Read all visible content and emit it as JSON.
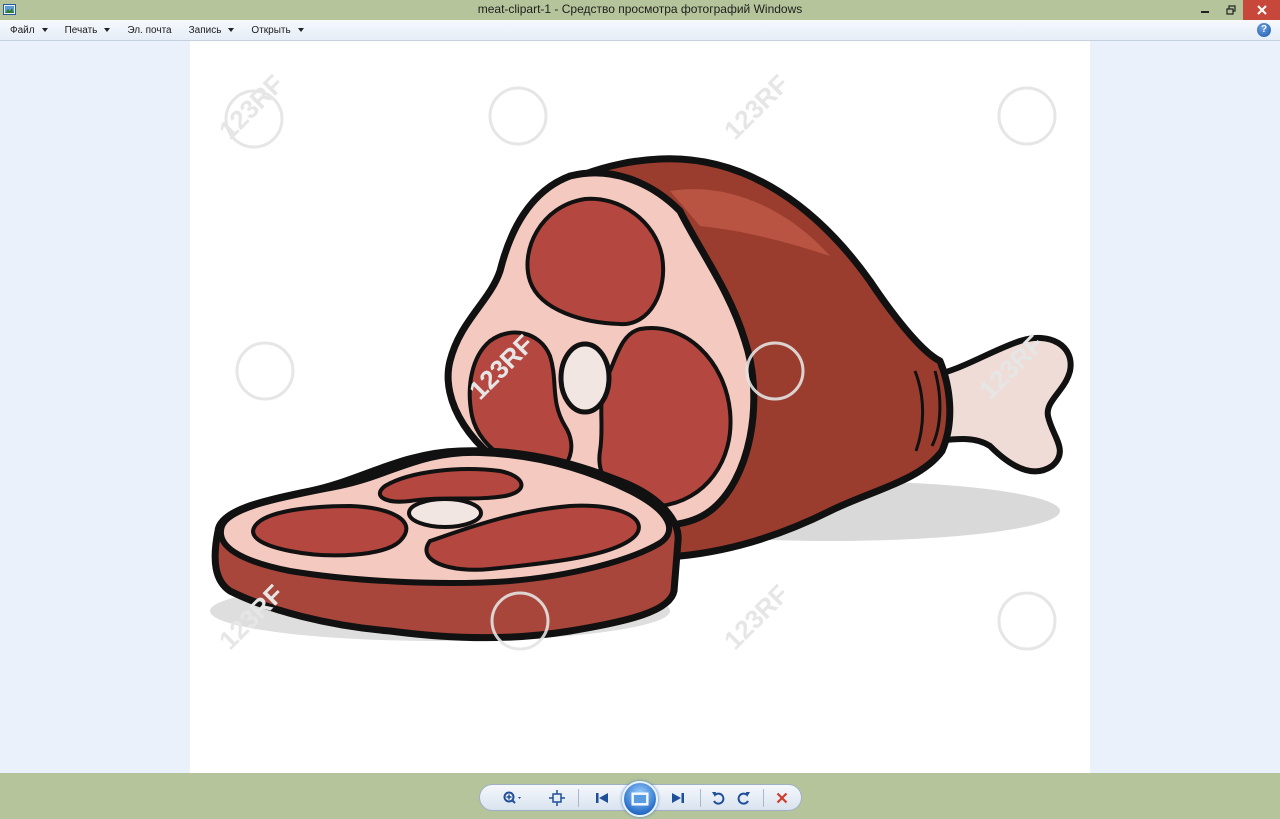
{
  "window": {
    "title": "meat-clipart-1 - Средство просмотра фотографий Windows"
  },
  "menu": {
    "items": [
      {
        "label": "Файл",
        "has_arrow": true
      },
      {
        "label": "Печать",
        "has_arrow": true
      },
      {
        "label": "Эл. почта",
        "has_arrow": false
      },
      {
        "label": "Запись",
        "has_arrow": true
      },
      {
        "label": "Открыть",
        "has_arrow": true
      }
    ],
    "help_label": "?"
  },
  "photo": {
    "subject": "cartoon ham with bone and a cut slice",
    "watermark_text": "123RF"
  },
  "toolbar": {
    "buttons": [
      "zoom-icon",
      "fit-window-icon",
      "previous-icon",
      "slideshow-icon",
      "next-icon",
      "rotate-left-icon",
      "rotate-right-icon",
      "delete-icon"
    ]
  },
  "colors": {
    "titlebar": "#b5c49a",
    "close_button": "#c7483a",
    "viewer_background": "#eaf1fa",
    "meat_dark": "#8e3a2c",
    "meat_light": "#b4473f",
    "fat": "#f2c9c1"
  }
}
